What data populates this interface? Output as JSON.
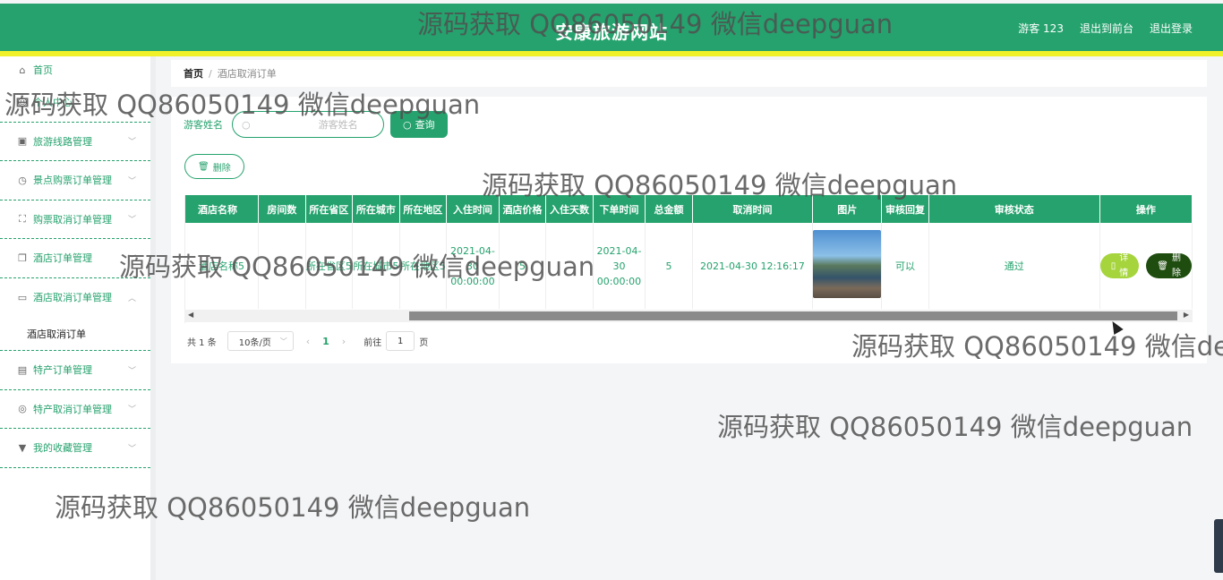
{
  "header": {
    "site_title": "安康旅游网站",
    "user": "游客 123",
    "to_front": "退出到前台",
    "logout": "退出登录"
  },
  "sidebar": {
    "items": [
      {
        "label": "首页",
        "icon": "home-icon"
      },
      {
        "label": "个人中心",
        "icon": "user-icon"
      },
      {
        "label": "旅游线路管理",
        "icon": "clipboard-icon"
      },
      {
        "label": "景点购票订单管理",
        "icon": "clock-icon"
      },
      {
        "label": "购票取消订单管理",
        "icon": "scan-icon"
      },
      {
        "label": "酒店订单管理",
        "icon": "copy-icon"
      },
      {
        "label": "酒店取消订单管理",
        "icon": "chat-icon"
      },
      {
        "label": "特产订单管理",
        "icon": "clipboard-icon"
      },
      {
        "label": "特产取消订单管理",
        "icon": "aperture-icon"
      },
      {
        "label": "我的收藏管理",
        "icon": "trophy-icon"
      }
    ],
    "submenu_label": "酒店取消订单"
  },
  "breadcrumb": {
    "home": "首页",
    "separator": "/",
    "current": "酒店取消订单"
  },
  "search": {
    "label": "游客姓名",
    "placeholder": "游客姓名",
    "button": "查询"
  },
  "toolbar": {
    "delete_label": "删除"
  },
  "table": {
    "headers": [
      "酒店名称",
      "房间数",
      "所在省区",
      "所在城市",
      "所在地区",
      "入住时间",
      "酒店价格",
      "入住天数",
      "下单时间",
      "总金额",
      "取消时间",
      "图片",
      "审核回复",
      "审核状态",
      "操作"
    ],
    "row": {
      "hotel": "酒店名称5",
      "rooms": "",
      "province": "所在省区5",
      "city": "所在城市5",
      "district": "所在地区5",
      "checkin_time": "2021-04-30 00:00:00",
      "price": "5",
      "days": "",
      "order_time": "2021-04-30 00:00:00",
      "total": "5",
      "cancel_time": "2021-04-30 12:16:17",
      "reply": "可以",
      "status": "通过",
      "detail_btn": "详情",
      "delete_btn": "删除"
    }
  },
  "pagination": {
    "total": "共 1 条",
    "page_size": "10条/页",
    "current_page": "1",
    "goto_label": "前往",
    "goto_value": "1",
    "page_suffix": "页"
  },
  "watermark": "源码获取 QQ86050149 微信deepguan",
  "colors": {
    "primary": "#25a26d",
    "header_strip": "#f1f12a",
    "detail_button": "#a5d43c",
    "delete_button": "#1f4d0f"
  }
}
